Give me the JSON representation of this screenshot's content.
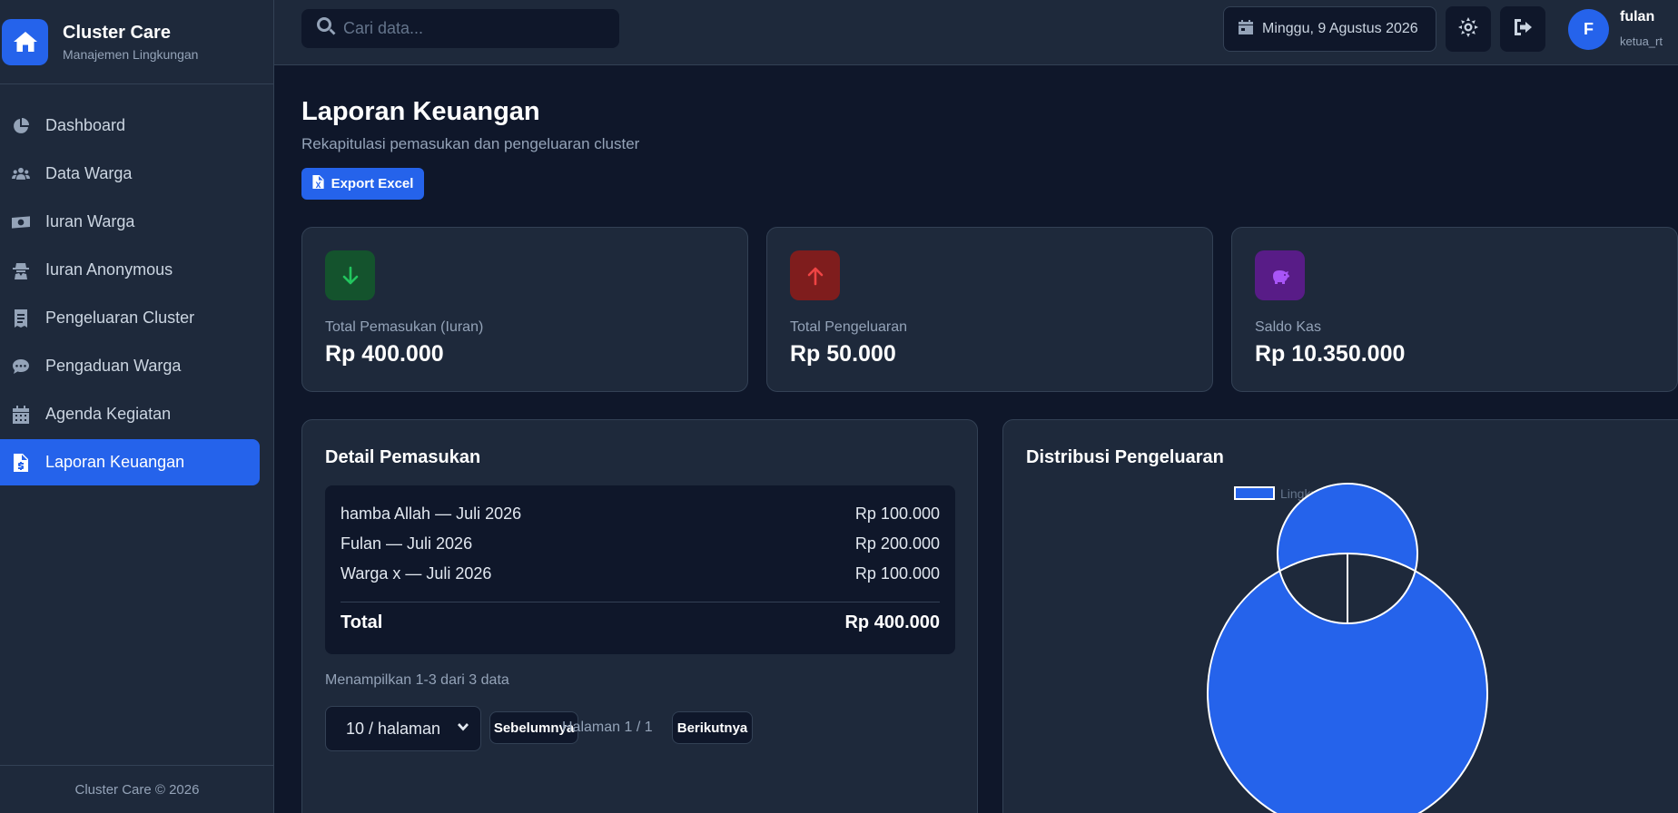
{
  "brand": {
    "title": "Cluster Care",
    "subtitle": "Manajemen Lingkungan"
  },
  "sidebar": {
    "items": [
      {
        "label": "Dashboard",
        "icon": "chart-pie-icon"
      },
      {
        "label": "Data Warga",
        "icon": "users-icon"
      },
      {
        "label": "Iuran Warga",
        "icon": "money-bill-icon"
      },
      {
        "label": "Iuran Anonymous",
        "icon": "user-secret-icon"
      },
      {
        "label": "Pengeluaran Cluster",
        "icon": "receipt-icon"
      },
      {
        "label": "Pengaduan Warga",
        "icon": "comments-icon"
      },
      {
        "label": "Agenda Kegiatan",
        "icon": "calendar-icon"
      },
      {
        "label": "Laporan Keuangan",
        "icon": "file-invoice-icon",
        "active": true
      }
    ],
    "footer": "Cluster Care © 2026"
  },
  "topbar": {
    "search_placeholder": "Cari data...",
    "date": "Minggu, 9 Agustus 2026",
    "user": {
      "initial": "F",
      "name": "fulan",
      "role": "ketua_rt"
    }
  },
  "page": {
    "title": "Laporan Keuangan",
    "subtitle": "Rekapitulasi pemasukan dan pengeluaran cluster",
    "export_label": "Export Excel"
  },
  "stats": [
    {
      "label": "Total Pemasukan (Iuran)",
      "value": "Rp 400.000",
      "icon": "arrow-down-icon",
      "icon_bg": "#14532d",
      "icon_color": "#22c55e"
    },
    {
      "label": "Total Pengeluaran",
      "value": "Rp 50.000",
      "icon": "arrow-up-icon",
      "icon_bg": "#7f1d1d",
      "icon_color": "#ef4444"
    },
    {
      "label": "Saldo Kas",
      "value": "Rp 10.350.000",
      "icon": "piggy-bank-icon",
      "icon_bg": "#581c87",
      "icon_color": "#a855f7"
    }
  ],
  "income": {
    "title": "Detail Pemasukan",
    "rows": [
      {
        "name": "hamba Allah — Juli 2026",
        "amount": "Rp 100.000"
      },
      {
        "name": "Fulan — Juli 2026",
        "amount": "Rp 200.000"
      },
      {
        "name": "Warga x — Juli 2026",
        "amount": "Rp 100.000"
      }
    ],
    "total_label": "Total",
    "total_value": "Rp 400.000",
    "showing": "Menampilkan 1-3 dari 3 data",
    "per_page": "10 / halaman",
    "prev_label": "Sebelumnya",
    "page_info": "Halaman 1 / 1",
    "next_label": "Berikutnya"
  },
  "expense_chart": {
    "title": "Distribusi Pengeluaran",
    "chart_data": {
      "type": "pie",
      "variant": "doughnut",
      "title": "",
      "series": [
        {
          "name": "Lingkungan",
          "value": 50000,
          "color": "#2563eb"
        }
      ],
      "legend_position": "top"
    }
  }
}
